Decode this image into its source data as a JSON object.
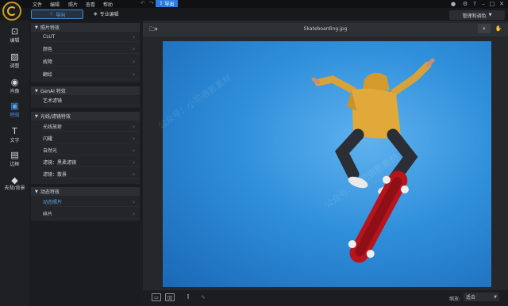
{
  "menubar": {
    "items": [
      "文件",
      "编辑",
      "照片",
      "查看",
      "帮助"
    ],
    "export_label": "导出"
  },
  "tabs": {
    "guide": "导向",
    "pro": "专业编辑",
    "manage": "管理和调色"
  },
  "rail": [
    {
      "label": "编辑",
      "icon": "crop-icon"
    },
    {
      "label": "调整",
      "icon": "image-adjust-icon"
    },
    {
      "label": "肖像",
      "icon": "portrait-icon"
    },
    {
      "label": "特效",
      "icon": "effects-icon"
    },
    {
      "label": "文字",
      "icon": "text-icon"
    },
    {
      "label": "边框",
      "icon": "frame-icon"
    },
    {
      "label": "去背/背景",
      "icon": "background-icon"
    }
  ],
  "groups": [
    {
      "title": "照片特效",
      "items": [
        "CLUT",
        "颜色",
        "故障",
        "翻绘"
      ]
    },
    {
      "title": "GenAI 特效",
      "items": [
        "艺术滤镜"
      ]
    },
    {
      "title": "光线/滤镜特效",
      "items": [
        "光线放射",
        "闪耀",
        "自然光",
        "滤镜：黑柔滤镜",
        "滤镜：散景"
      ]
    },
    {
      "title": "动态特效",
      "items": [
        "动态照片",
        "碎片"
      ]
    }
  ],
  "canvas": {
    "filename": "Skateboarding.jpg"
  },
  "status": {
    "zoom_label": "缩放:",
    "zoom_value": "适合"
  },
  "watermark": "公众号：小司摄影素材"
}
